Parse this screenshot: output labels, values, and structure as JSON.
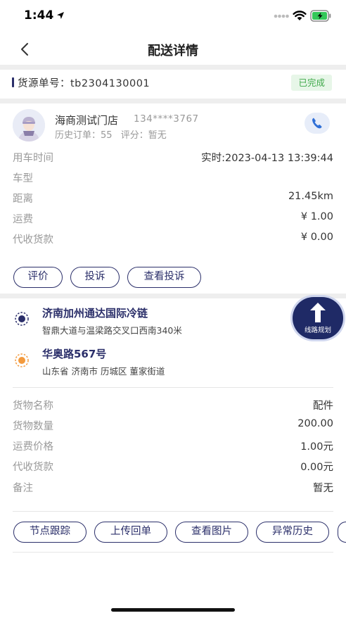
{
  "status_bar": {
    "time": "1:44"
  },
  "nav": {
    "title": "配送详情"
  },
  "order": {
    "label": "货源单号：",
    "number": "tb2304130001",
    "status": "已完成"
  },
  "shop": {
    "name": "海商测试门店",
    "phone": "134****3767",
    "history_label": "历史订单：",
    "history_count": "55",
    "rating_label": "评分：",
    "rating_value": "暂无"
  },
  "details": [
    {
      "label": "用车时间",
      "value": "实时:2023-04-13 13:39:44"
    },
    {
      "label": "车型",
      "value": ""
    },
    {
      "label": "距离",
      "value": "21.45km"
    },
    {
      "label": "运费",
      "value": "¥ 1.00"
    },
    {
      "label": "代收货款",
      "value": "¥ 0.00"
    }
  ],
  "actions": {
    "review": "评价",
    "complain": "投诉",
    "view_complaints": "查看投诉"
  },
  "route": {
    "from_title": "济南加州通达国际冷链",
    "from_address": "智鼎大道与温梁路交叉口西南340米",
    "to_title": "华奥路567号",
    "to_address": "山东省 济南市 历城区 董家街道",
    "plan_label": "线路规划"
  },
  "goods": [
    {
      "label": "货物名称",
      "value": "配件"
    },
    {
      "label": "货物数量",
      "value": "200.00"
    },
    {
      "label": "运费价格",
      "value": "1.00元"
    },
    {
      "label": "代收货款",
      "value": "0.00元"
    },
    {
      "label": "备注",
      "value": "暂无"
    }
  ],
  "bottom_actions": {
    "track": "节点跟踪",
    "upload": "上传回单",
    "view_images": "查看图片",
    "exception_history": "异常历史"
  },
  "colors": {
    "brand": "#2b2f6a",
    "success": "#3fa94a",
    "pickup": "#2b2f6a",
    "dropoff": "#f39a3d"
  }
}
